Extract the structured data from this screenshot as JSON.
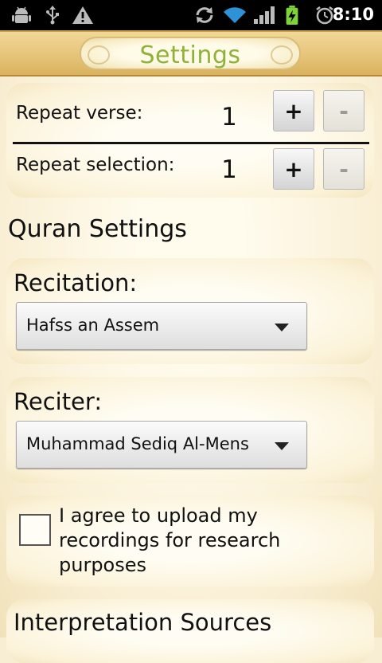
{
  "status_bar": {
    "time": "8:10",
    "icons": [
      "android-debug-icon",
      "usb-icon",
      "warning-icon",
      "sync-icon",
      "wifi-icon",
      "signal-icon",
      "battery-charging-icon",
      "alarm-icon"
    ]
  },
  "header": {
    "title": "Settings"
  },
  "repeat": {
    "verse_label": "Repeat verse:",
    "verse_value": "1",
    "selection_label": "Repeat selection:",
    "selection_value": "1",
    "plus_label": "+",
    "minus_label": "-"
  },
  "quran_settings": {
    "heading": "Quran Settings",
    "recitation_label": "Recitation:",
    "recitation_value": "Hafss an Assem",
    "reciter_label": "Reciter:",
    "reciter_value": "Muhammad Sediq Al-Menshawi"
  },
  "agree": {
    "text": "I agree to upload my recordings for research purposes",
    "checked": false
  },
  "interpretation": {
    "heading": "Interpretation Sources"
  },
  "colors": {
    "title_green": "#8fb23a",
    "header_gold": "#e6c47a",
    "page_cream": "#f8eed4"
  }
}
